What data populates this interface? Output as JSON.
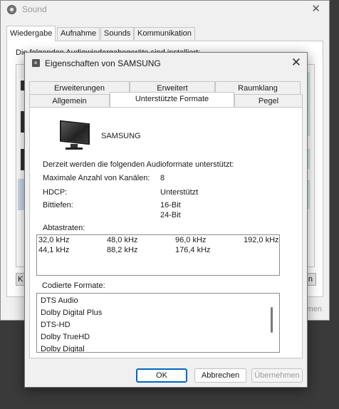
{
  "sound_window": {
    "title": "Sound",
    "close": "✕",
    "tabs": [
      "Wiedergabe",
      "Aufnahme",
      "Sounds",
      "Kommunikation"
    ],
    "intro": "Die folgenden Audiowiedergabegeräte sind installiert:",
    "btn_left": "K",
    "btn_right": "n",
    "btn_bottom": "nmen"
  },
  "dialog": {
    "title": "Eigenschaften von SAMSUNG",
    "close": "✕",
    "tabs_top": [
      "Erweiterungen",
      "Erweitert",
      "Raumklang"
    ],
    "tabs_bottom": [
      "Allgemein",
      "Unterstützte Formate",
      "Pegel"
    ],
    "device_name": "SAMSUNG",
    "intro": "Derzeit werden die folgenden Audioformate unterstützt:",
    "props": {
      "channels_label": "Maximale Anzahl von Kanälen:",
      "channels_value": "8",
      "hdcp_label": "HDCP:",
      "hdcp_value": "Unterstützt",
      "bitdepth_label": "Bittiefen:",
      "bitdepth_values": [
        "16-Bit",
        "24-Bit"
      ]
    },
    "sample_rates_label": "Abtastraten:",
    "sample_rates": [
      [
        "32,0 kHz",
        "48,0 kHz",
        "96,0 kHz",
        "192,0 kHz"
      ],
      [
        "44,1 kHz",
        "88,2 kHz",
        "176,4 kHz"
      ]
    ],
    "coded_label": "Codierte Formate:",
    "coded_formats": [
      "DTS Audio",
      "Dolby Digital Plus",
      "DTS-HD",
      "Dolby TrueHD",
      "Dolby Digital"
    ],
    "buttons": {
      "ok": "OK",
      "cancel": "Abbrechen",
      "apply": "Übernehmen"
    }
  }
}
